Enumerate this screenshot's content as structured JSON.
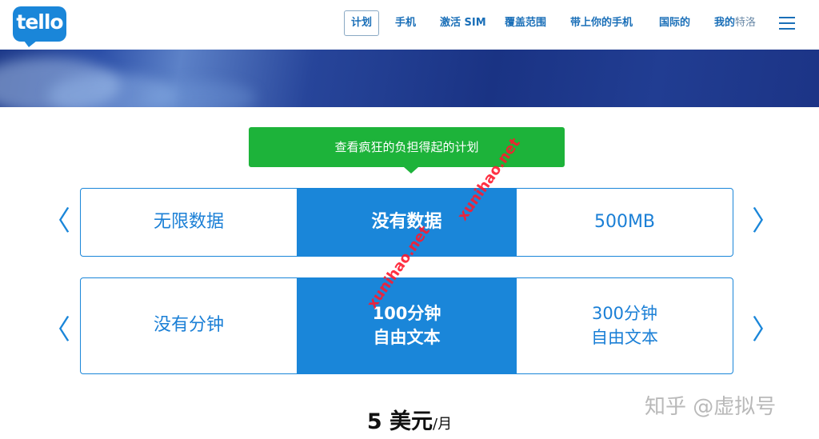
{
  "header": {
    "logo_text": "tello",
    "nav": [
      {
        "label": "计划"
      },
      {
        "label": "手机"
      },
      {
        "label": "激活 SIM"
      },
      {
        "label": "覆盖范围"
      },
      {
        "label": "带上你的手机"
      },
      {
        "label": "国际的"
      },
      {
        "label": "我的",
        "suffix": "特洛"
      }
    ]
  },
  "callout": {
    "text": "查看疯狂的负担得起的计划"
  },
  "data_options": {
    "items": [
      {
        "label": "无限数据"
      },
      {
        "label": "没有数据"
      },
      {
        "label": "500MB"
      }
    ],
    "selected": "没有数据"
  },
  "minutes_options": {
    "items": [
      {
        "line1": "没有分钟",
        "line2": ""
      },
      {
        "line1": "100分钟",
        "line2": "自由文本"
      },
      {
        "line1": "300分钟",
        "line2": "自由文本"
      }
    ],
    "selected": "100分钟"
  },
  "arrows": {
    "prev": "〈",
    "next": "〉"
  },
  "price": {
    "amount": "5 美元",
    "per": "/月"
  },
  "watermark": {
    "text": "xunihao.net",
    "credit": "知乎 @虚拟号"
  },
  "colors": {
    "brand_blue": "#1a86d9",
    "callout_green": "#1db33a",
    "watermark_red": "#ff1a2e"
  }
}
